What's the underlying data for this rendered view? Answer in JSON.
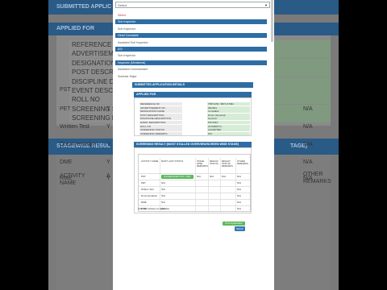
{
  "background": {
    "header": "SUBMITTED APPLIC",
    "applied_for": "APPLIED FOR",
    "fields": [
      "REFERENCE NO",
      "ADVERTISEMENT",
      "DESIGNATION NAM",
      "POST DESCRIPTIO",
      "DISCIPLINE DESC",
      "EVENT DESCRIPTI",
      "ROLL NO",
      "SCREENING STAT",
      "SCREENING REMA"
    ],
    "stage_header": "STAGEWISE RESUL",
    "stage_right": "TAGE)",
    "col_activity": "ACTIVITY NAME",
    "col_activity_short": "A",
    "col_other": "OTHER REMARKS",
    "rows": [
      {
        "name": "PST",
        "a": "",
        "other": ""
      },
      {
        "name": "PET",
        "a": "Y",
        "other": "N/A"
      },
      {
        "name": "Written Test",
        "a": "Y",
        "other": "N/A"
      },
      {
        "name": "Documentation",
        "a": "Y",
        "other": "N/A"
      },
      {
        "name": "DME",
        "a": "Y",
        "other": "N/A"
      },
      {
        "name": "RME",
        "a": "Y",
        "other": "N/A"
      }
    ]
  },
  "modal": {
    "select_value": "Select",
    "dropdown": [
      {
        "label": "Select",
        "style": "red"
      },
      {
        "label": "Sub Inspector",
        "style": "hl"
      },
      {
        "label": "Sub Inspector",
        "style": ""
      },
      {
        "label": "Head Constable",
        "style": "hl"
      },
      {
        "label": "Assistant Sub Inspector",
        "style": ""
      },
      {
        "label": "ASI",
        "style": "hl"
      },
      {
        "label": "Sub Inspector",
        "style": ""
      },
      {
        "label": "Inspector (Ministerial)",
        "style": "hl"
      },
      {
        "label": "Assistant Commandant",
        "style": ""
      },
      {
        "label": "Subedar Major",
        "style": ""
      }
    ],
    "submitted_title": "SUBMITTED APPLICATION DETAILS",
    "applied_for_title": "APPLIED FOR",
    "details": [
      {
        "k": "REFERENCE NO",
        "v": "75871254 / 8871-57094"
      },
      {
        "k": "ADVERTISEMENT NO",
        "v": "06/2024"
      },
      {
        "k": "DESIGNATION NAME",
        "v": "Constable"
      },
      {
        "k": "POST DESCRIPTION",
        "v": "Driver (General)"
      },
      {
        "k": "DISCIPLINE DESCRIPTION",
        "v": "General"
      },
      {
        "k": "EVENT DESCRIPTION",
        "v": "PST/PET"
      },
      {
        "k": "ROLL NO",
        "v": "2471880774"
      },
      {
        "k": "SCREENING STATUS",
        "v": "ACCEPTED"
      },
      {
        "k": "SCREENING REMARKS",
        "v": "N/A"
      }
    ],
    "stage_title": "SCREENING RESULT (MOST STALLED OVERVIEW/SCREEN WISE STAGE)",
    "table_headers": [
      "ACTIVITY NAME",
      "MOST LAST STATUS",
      "STAGE WISE REMARKS",
      "RESULT STATUS",
      "RESULT STATUS REMARKS",
      "OTHER REMARKS"
    ],
    "rows": [
      {
        "name": "PST",
        "status": "",
        "stage": "N/A",
        "result": "N/A",
        "res_remarks": "N/A",
        "other": "N/A"
      },
      {
        "name": "PET",
        "status": "N/A",
        "stage": "",
        "result": "",
        "res_remarks": "",
        "other": "N/A"
      },
      {
        "name": "Written Test",
        "status": "N/A",
        "stage": "",
        "result": "",
        "res_remarks": "",
        "other": "N/A"
      },
      {
        "name": "Documentation",
        "status": "N/A",
        "stage": "",
        "result": "",
        "res_remarks": "",
        "other": "N/A"
      },
      {
        "name": "DME",
        "status": "N/A",
        "stage": "",
        "result": "",
        "res_remarks": "",
        "other": "N/A"
      },
      {
        "name": "RME",
        "status": "N/A",
        "stage": "",
        "result": "",
        "res_remarks": "",
        "other": "N/A"
      }
    ],
    "pst_button": "SCHEDULED PST / PET",
    "note": "Note: N/A indicates not applicable.",
    "print_button": "Print Application",
    "back_button": "BACK"
  }
}
